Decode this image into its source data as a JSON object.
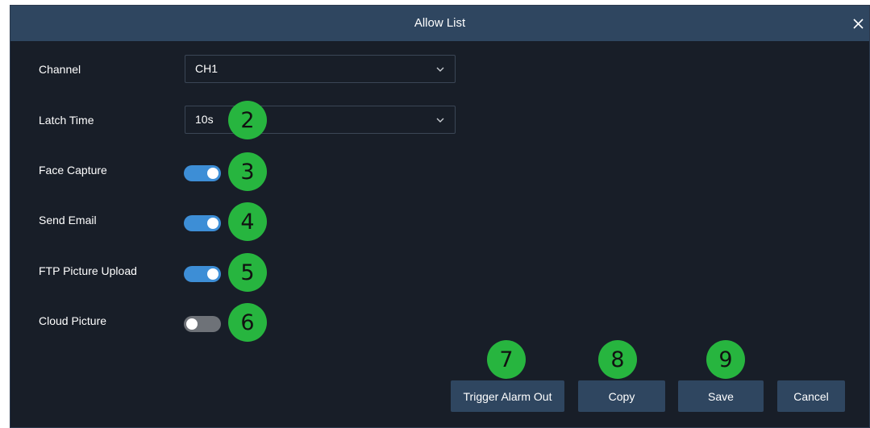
{
  "dialog": {
    "title": "Allow List",
    "close_icon": "close-icon"
  },
  "fields": {
    "channel": {
      "label": "Channel",
      "value": "CH1"
    },
    "latch_time": {
      "label": "Latch Time",
      "value": "10s"
    },
    "face_capture": {
      "label": "Face Capture",
      "enabled": true
    },
    "send_email": {
      "label": "Send Email",
      "enabled": true
    },
    "ftp_picture_upload": {
      "label": "FTP Picture Upload",
      "enabled": true
    },
    "cloud_picture": {
      "label": "Cloud Picture",
      "enabled": false
    }
  },
  "callouts": [
    "2",
    "3",
    "4",
    "5",
    "6",
    "7",
    "8",
    "9"
  ],
  "buttons": {
    "trigger_alarm_out": "Trigger Alarm Out",
    "copy": "Copy",
    "save": "Save",
    "cancel": "Cancel"
  },
  "colors": {
    "header": "#2f4660",
    "background": "#181e28",
    "toggle_on": "#3d8ed6",
    "toggle_off": "#6e7278",
    "callout": "#27b53f"
  }
}
